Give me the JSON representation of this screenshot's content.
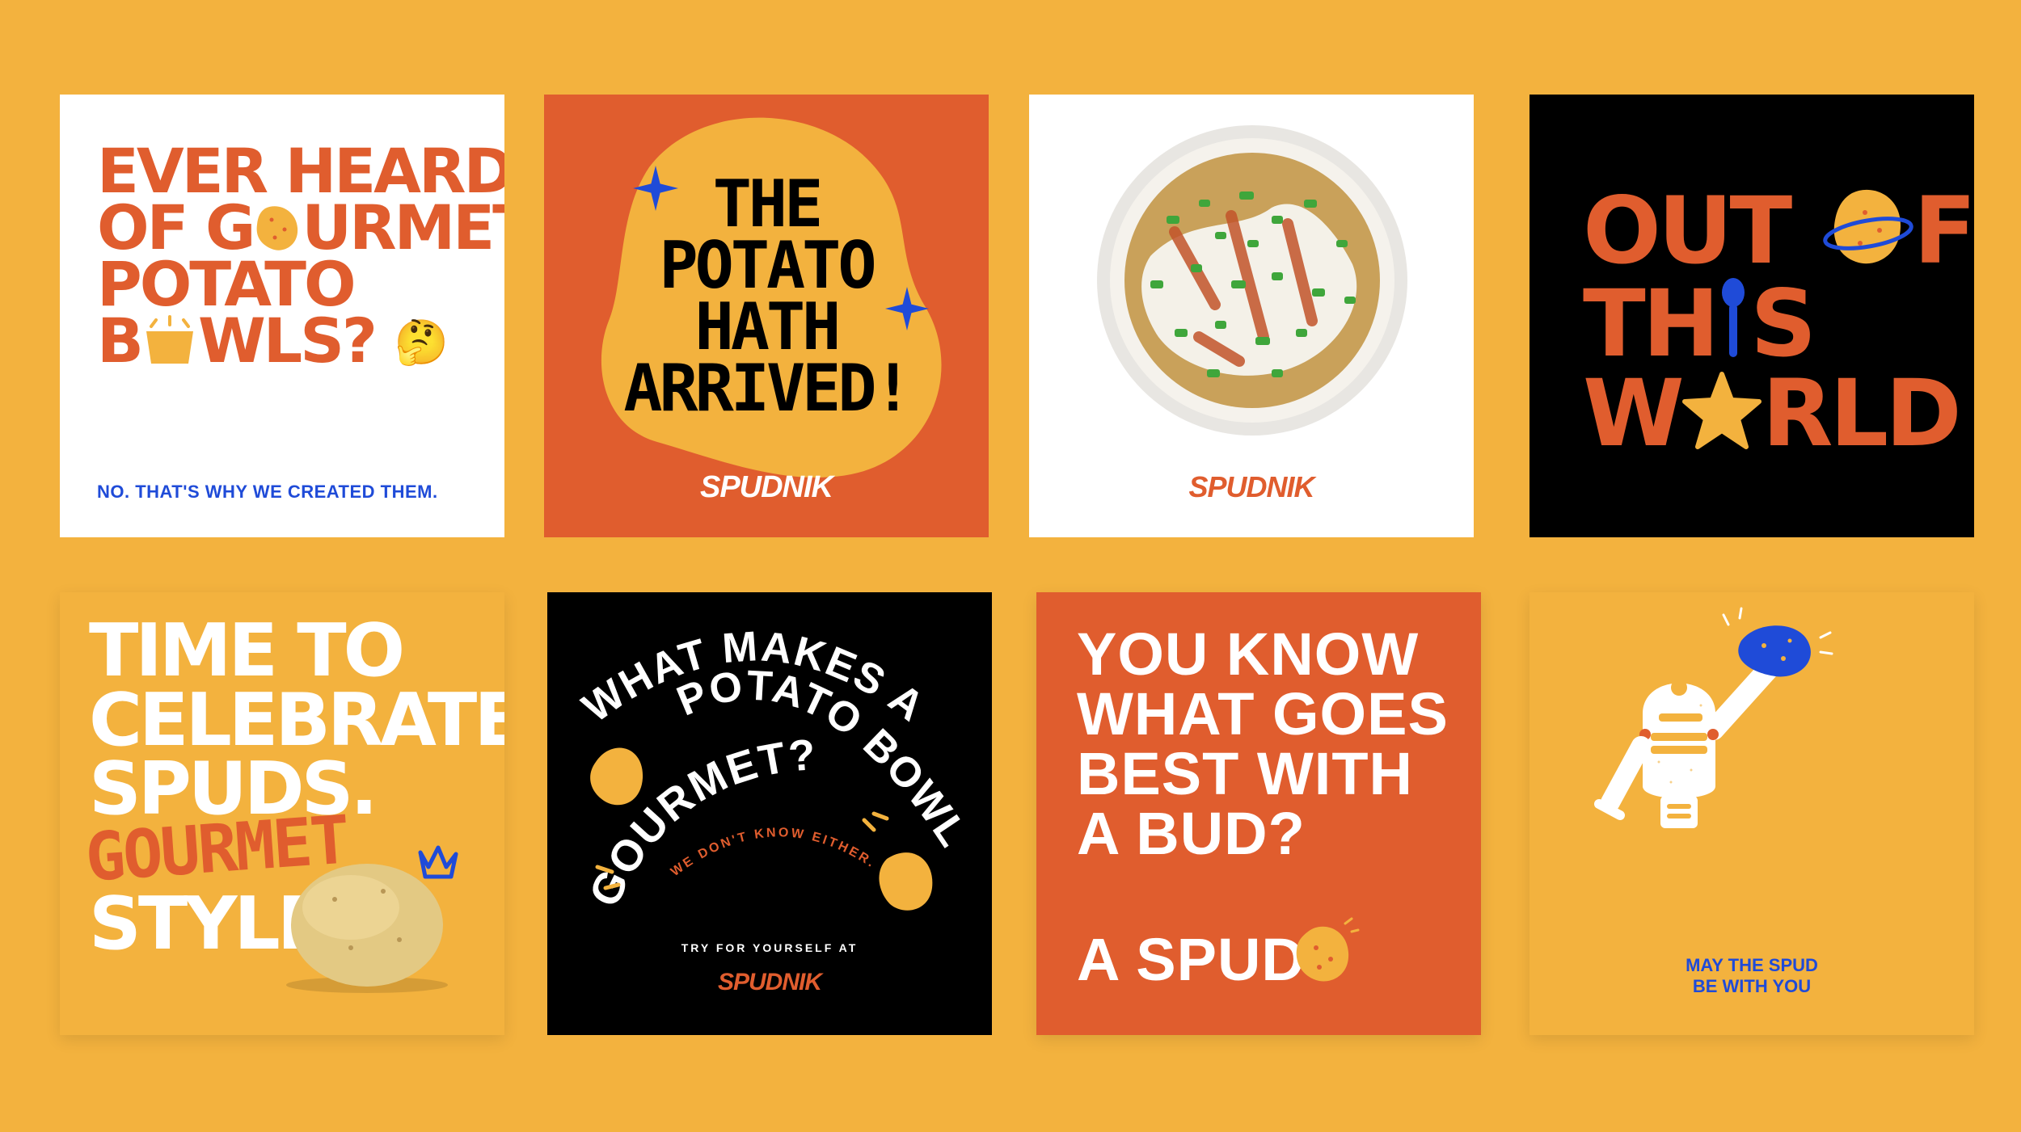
{
  "colors": {
    "background": "#F3B23E",
    "orange": "#E05D2E",
    "blue": "#1F4BD8",
    "black": "#000000",
    "white": "#FFFFFF",
    "potato": "#F3B23E"
  },
  "tile1": {
    "line1": "EVER HEARD",
    "line2a": "OF G",
    "line2b": "URMET",
    "line3": "POTATO",
    "line4a": "B",
    "line4b": "WLS?",
    "emoji": "🤔",
    "subtitle": "NO. THAT'S WHY WE CREATED THEM."
  },
  "tile2": {
    "lines": [
      "THE",
      "POTATO",
      "HATH",
      "ARRIVED!"
    ],
    "brand": "SPUDNIK"
  },
  "tile3": {
    "brand": "SPUDNIK"
  },
  "tile4": {
    "line1": "OUT",
    "line1b": "F",
    "line2a": "TH",
    "line2b": "S",
    "line3a": "W",
    "line3b": "RLD"
  },
  "tile5": {
    "lines": [
      "TIME TO",
      "CELEBRATE",
      "SPUDS."
    ],
    "accent": "GOURMET",
    "last": "STYLE."
  },
  "tile6": {
    "arc_line1": "WHAT MAKES A",
    "arc_line2": "POTATO BOWL",
    "arc_line3": "GOURMET?",
    "arc_small": "WE DON'T KNOW EITHER.",
    "cta": "TRY FOR YOURSELF AT",
    "brand": "SPUDNIK"
  },
  "tile7": {
    "lines": [
      "YOU KNOW",
      "WHAT GOES",
      "BEST WITH",
      "A BUD?"
    ],
    "answer": "A SPUD"
  },
  "tile8": {
    "line1": "MAY THE SPUD",
    "line2": "BE WITH YOU"
  }
}
